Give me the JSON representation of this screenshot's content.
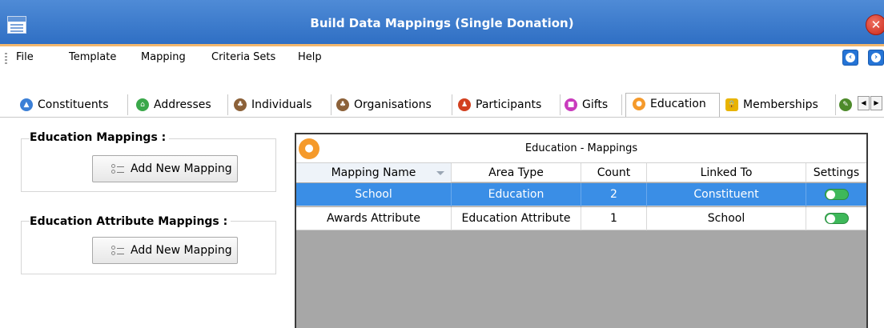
{
  "window": {
    "title": "Build Data Mappings (Single Donation)"
  },
  "menu": {
    "items": [
      "File",
      "Template",
      "Mapping",
      "Criteria Sets",
      "Help"
    ]
  },
  "tabs": [
    {
      "label": "Constituents",
      "icon": "constituents-icon",
      "color": "#3b7fd6"
    },
    {
      "label": "Addresses",
      "icon": "addresses-icon",
      "color": "#3aa84a"
    },
    {
      "label": "Individuals",
      "icon": "individuals-icon",
      "color": "#8c6139"
    },
    {
      "label": "Organisations",
      "icon": "organisations-icon",
      "color": "#8c6139"
    },
    {
      "label": "Participants",
      "icon": "participants-icon",
      "color": "#d2401f"
    },
    {
      "label": "Gifts",
      "icon": "gifts-icon",
      "color": "#c93bbd"
    },
    {
      "label": "Education",
      "icon": "education-icon",
      "color": "#f59a2b",
      "active": true
    },
    {
      "label": "Memberships",
      "icon": "lock-icon",
      "color": "#e8b400"
    }
  ],
  "left": {
    "education_group": {
      "title": "Education Mappings :",
      "button": "Add New Mapping"
    },
    "attribute_group": {
      "title": "Education Attribute Mappings :",
      "button": "Add New Mapping"
    }
  },
  "grid": {
    "title": "Education - Mappings",
    "columns": [
      "Mapping Name",
      "Area Type",
      "Count",
      "Linked To",
      "Settings"
    ],
    "rows": [
      {
        "name": "School",
        "area": "Education",
        "count": "2",
        "linked": "Constituent",
        "enabled": true,
        "selected": true
      },
      {
        "name": "Awards Attribute",
        "area": "Education Attribute",
        "count": "1",
        "linked": "School",
        "enabled": true,
        "selected": false
      }
    ]
  },
  "colors": {
    "titlebar": "#3a78cc",
    "accent_orange": "#f59a2b",
    "selection": "#3a8ee6",
    "toggle_on": "#3eb85a"
  }
}
